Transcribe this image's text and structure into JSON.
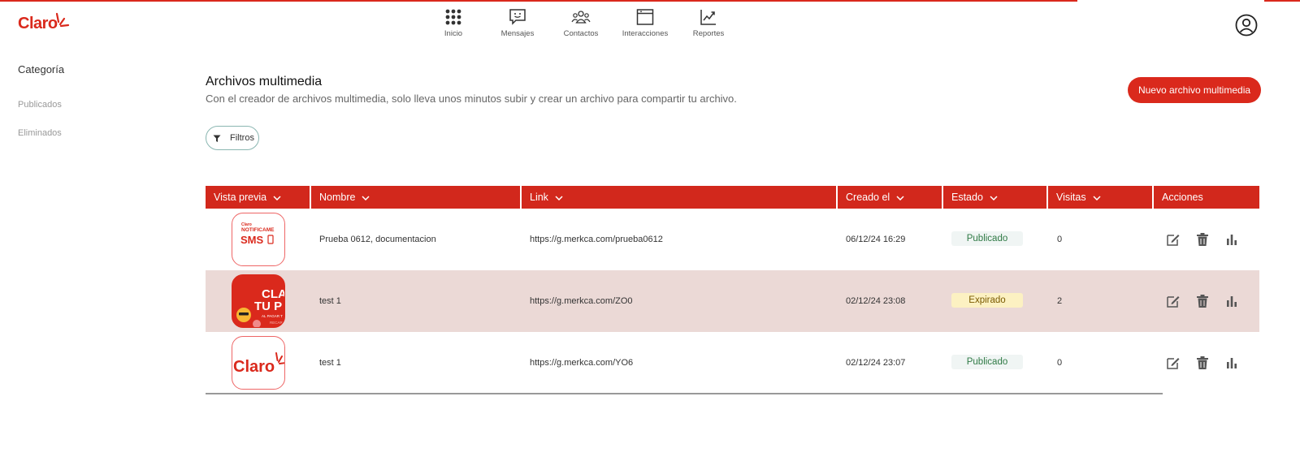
{
  "brand": {
    "logo_text": "Claro",
    "accent": "#da291c"
  },
  "nav": {
    "items": [
      {
        "label": "Inicio",
        "icon": "grid-dots-icon"
      },
      {
        "label": "Mensajes",
        "icon": "chat-bubble-icon"
      },
      {
        "label": "Contactos",
        "icon": "people-icon"
      },
      {
        "label": "Interacciones",
        "icon": "window-icon"
      },
      {
        "label": "Reportes",
        "icon": "trend-chart-icon"
      }
    ]
  },
  "user": {
    "icon": "user-circle-icon"
  },
  "sidebar": {
    "title": "Categoría",
    "items": [
      {
        "label": "Publicados"
      },
      {
        "label": "Eliminados"
      }
    ]
  },
  "main": {
    "title": "Archivos multimedia",
    "subtitle": "Con el creador de archivos multimedia, solo lleva unos minutos subir y crear un archivo para compartir tu archivo.",
    "new_button": "Nuevo archivo multimedia",
    "filter_button": "Filtros"
  },
  "table": {
    "headers": [
      "Vista previa",
      "Nombre",
      "Link",
      "Creado el",
      "Estado",
      "Visitas",
      "Acciones"
    ],
    "rows": [
      {
        "preview": {
          "type": "sms",
          "brand": "Claro",
          "line1": "NOTIFICAME",
          "line2": "SMS"
        },
        "name": "Prueba 0612, documentacion",
        "link": "https://g.merkca.com/prueba0612",
        "created": "06/12/24 16:29",
        "status": "Publicado",
        "visits": "0"
      },
      {
        "preview": {
          "type": "promo",
          "line1": "CLA",
          "line2": "TU P",
          "line3": "AL PAGAR T",
          "line4": "RECAR"
        },
        "name": "test 1",
        "link": "https://g.merkca.com/ZO0",
        "created": "02/12/24 23:08",
        "status": "Expirado",
        "visits": "2"
      },
      {
        "preview": {
          "type": "logo",
          "brand": "Claro"
        },
        "name": "test 1",
        "link": "https://g.merkca.com/YO6",
        "created": "02/12/24 23:07",
        "status": "Publicado",
        "visits": "0"
      }
    ],
    "action_icons": [
      "edit-icon",
      "trash-icon",
      "bar-chart-icon"
    ]
  },
  "colors": {
    "header_red": "#d2281c",
    "published_text": "#2f7a45",
    "expired_bg": "#fcf1c2",
    "selected_row": "#ebd9d6"
  }
}
